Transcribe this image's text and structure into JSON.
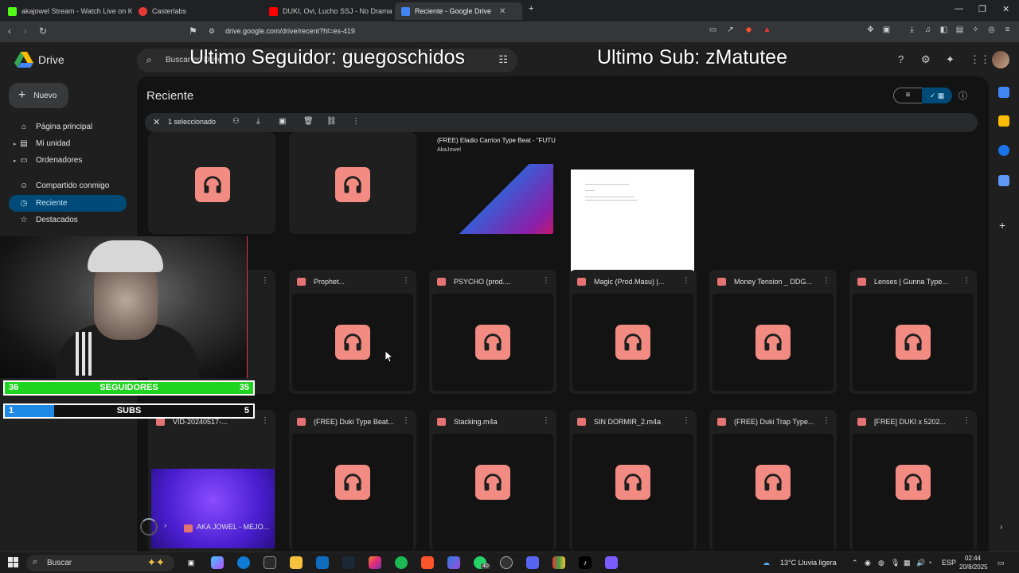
{
  "browser": {
    "tabs": [
      {
        "title": "akajowel Stream - Watch Live on Kick",
        "color": "#53fc18"
      },
      {
        "title": "Casterlabs",
        "color": "#e53935"
      },
      {
        "title": "DUKI, Ovi, Lucho SSJ - No Drama - Yo",
        "color": "#ff0000"
      },
      {
        "title": "Reciente - Google Drive",
        "color": "#4285f4"
      }
    ],
    "url": "drive.google.com/drive/recent?hl=es-419"
  },
  "drive": {
    "app_name": "Drive",
    "search_placeholder": "Buscar en Drive",
    "new_button": "Nuevo",
    "sidebar": [
      {
        "label": "Página principal",
        "icon": "home-icon"
      },
      {
        "label": "Mi unidad",
        "icon": "drive-icon"
      },
      {
        "label": "Ordenadores",
        "icon": "computer-icon"
      },
      {
        "label": "Compartido conmigo",
        "icon": "people-icon"
      },
      {
        "label": "Reciente",
        "icon": "clock-icon",
        "active": true
      },
      {
        "label": "Destacados",
        "icon": "star-icon"
      }
    ],
    "page_title": "Reciente",
    "selection_text": "1 seleccionado",
    "top_row": {
      "video_title": "(FREE) Eladio Carrion Type Beat - \"FUTU",
      "video_channel": "AkaJowel"
    },
    "row2": [
      "Prophet...",
      "PSYCHO (prod....",
      "Magic (Prod.Masu) |...",
      "Money Tension _ DDG...",
      "Lenses | Gunna Type..."
    ],
    "row3": [
      "VID-20240517-...",
      "(FREE) Duki Type Beat...",
      "Stacking.m4a",
      "SIN DORMIR_2.m4a",
      "(FREE) Duki Trap Type...",
      "[FREE] DUKI x 5202..."
    ],
    "upload_item": "AKA JOWEL - MEJO..."
  },
  "overlay": {
    "last_follower": "Ultimo Seguidor: guegoschidos",
    "last_sub": "Ultimo Sub: zMatutee",
    "followers_goal": {
      "current": "36",
      "label": "SEGUIDORES",
      "target": "35",
      "progress": 1.0,
      "color": "#1fd41f"
    },
    "subs_goal": {
      "current": "1",
      "label": "SUBS",
      "target": "5",
      "progress": 0.2,
      "color": "#1e88e5"
    }
  },
  "taskbar": {
    "search": "Buscar",
    "weather": "13°C  Lluvia ligera",
    "lang": "ESP",
    "time": "02:44",
    "date": "20/8/2025",
    "whatsapp_badge": "40"
  }
}
